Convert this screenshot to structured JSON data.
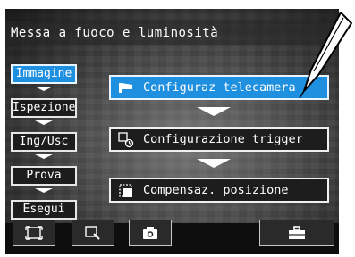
{
  "header": {
    "title": "Messa a fuoco e luminosità"
  },
  "nav": {
    "items": [
      {
        "label": "Immagine",
        "active": true
      },
      {
        "label": "Ispezione",
        "active": false
      },
      {
        "label": "Ing/Usc",
        "active": false
      },
      {
        "label": "Prova",
        "active": false
      },
      {
        "label": "Esegui",
        "active": false
      }
    ]
  },
  "actions": {
    "items": [
      {
        "label": "Configuraz telecamera",
        "icon": "camera-settings-icon",
        "active": true
      },
      {
        "label": "Configurazione trigger",
        "icon": "trigger-settings-icon",
        "active": false
      },
      {
        "label": "Compensaz. posizione",
        "icon": "position-compensation-icon",
        "active": false
      }
    ]
  },
  "toolbar": {
    "buttons": [
      {
        "icon": "fit-view-icon"
      },
      {
        "icon": "zoom-icon"
      },
      {
        "icon": "capture-image-icon"
      },
      {
        "icon": "toolbox-icon"
      }
    ]
  },
  "colors": {
    "accent": "#1f8fe0",
    "panel": "#1c1c1c",
    "border": "#e6e6e6"
  }
}
